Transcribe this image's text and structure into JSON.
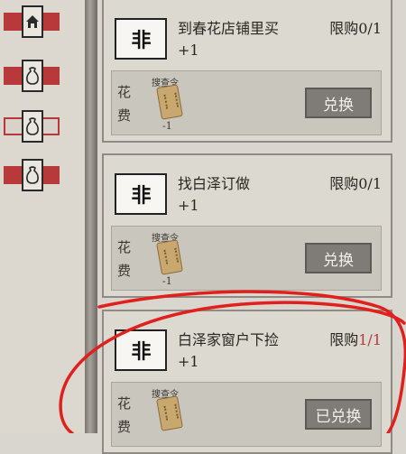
{
  "sidebar": {
    "tabs": [
      {
        "icon": "house-icon"
      },
      {
        "icon": "pouch-icon"
      },
      {
        "icon": "pouch-icon",
        "selected": true
      },
      {
        "icon": "pouch-icon"
      }
    ]
  },
  "items": [
    {
      "title": "到春花店铺里买",
      "quantity": "+1",
      "limit_label": "限购",
      "limit_count": "0/1",
      "cost_label": "花费",
      "token_name": "搜查令",
      "token_qty": "-1",
      "button": "兑换",
      "icon_text": "非"
    },
    {
      "title": "找白泽订做",
      "quantity": "+1",
      "limit_label": "限购",
      "limit_count": "0/1",
      "cost_label": "花费",
      "token_name": "搜查令",
      "token_qty": "-1",
      "button": "兑换",
      "icon_text": "非"
    },
    {
      "title": "白泽家窗户下捡",
      "quantity": "+1",
      "limit_label": "限购",
      "limit_count": "1/1",
      "cost_label": "花费",
      "token_name": "搜查令",
      "token_qty": "",
      "button": "已兑换",
      "icon_text": "非"
    }
  ],
  "colors": {
    "accent_red": "#b8393a",
    "button_gray": "#7f7c77"
  }
}
